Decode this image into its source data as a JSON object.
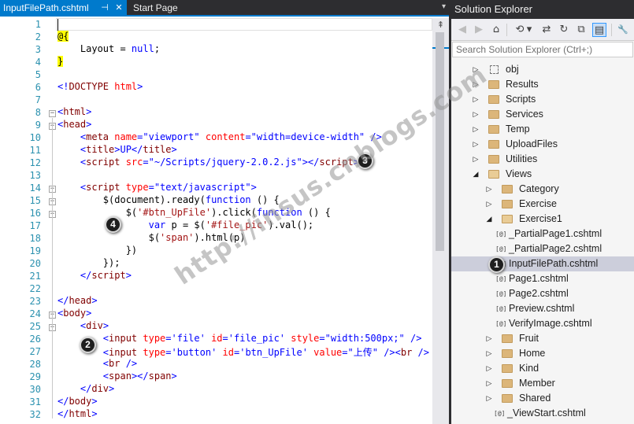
{
  "editor": {
    "active_tab": "InputFilePath.cshtml",
    "active_tab_pin": "⊣",
    "active_tab_close": "✕",
    "second_tab": "Start Page",
    "dropdown": "▾",
    "splitter": "⇞",
    "line_numbers": [
      "1",
      "2",
      "3",
      "4",
      "5",
      "6",
      "7",
      "8",
      "9",
      "10",
      "11",
      "12",
      "13",
      "14",
      "15",
      "16",
      "17",
      "18",
      "19",
      "20",
      "21",
      "22",
      "23",
      "24",
      "25",
      "26",
      "27",
      "28",
      "29",
      "30",
      "31",
      "32"
    ],
    "code": {
      "l2": "@{",
      "l3_a": "    Layout = ",
      "l3_b": "null",
      "l3_c": ";",
      "l4": "}",
      "l6_a": "<!",
      "l6_b": "DOCTYPE",
      "l6_c": " html",
      "l6_d": ">",
      "l8_a": "<",
      "l8_b": "html",
      "l8_c": ">",
      "l9_b": "head",
      "l10_a": "    <",
      "l10_b": "meta",
      "l10_c": " name",
      "l10_d": "=\"viewport\"",
      "l10_e": " content",
      "l10_f": "=\"width=device-width\"",
      "l10_g": " />",
      "l11_a": "    <",
      "l11_b": "title",
      "l11_c": ">UP</",
      "l11_d": "title",
      "l11_e": ">",
      "l12_a": "    <",
      "l12_b": "script",
      "l12_c": " src",
      "l12_d": "=\"~/Scripts/jquery-2.0.2.js\"",
      "l12_e": "></",
      "l12_f": "script",
      "l12_g": ">",
      "l14_a": "    <",
      "l14_b": "script",
      "l14_c": " type",
      "l14_d": "=\"text/javascript\"",
      "l14_e": ">",
      "l15_a": "        $(document).ready(",
      "l15_b": "function",
      "l15_c": " () {",
      "l16_a": "            $(",
      "l16_b": "'#btn_UpFile'",
      "l16_c": ").click(",
      "l16_d": "function",
      "l16_e": " () {",
      "l17_a": "                ",
      "l17_b": "var",
      "l17_c": " p = $(",
      "l17_d": "'#file_pic'",
      "l17_e": ").val();",
      "l18_a": "                $(",
      "l18_b": "'span'",
      "l18_c": ").html(p)",
      "l19": "            })",
      "l20": "        });",
      "l21_a": "    </",
      "l21_b": "script",
      "l21_c": ">",
      "l23_a": "</",
      "l23_b": "head",
      "l23_c": ">",
      "l24_b": "body",
      "l25_a": "    <",
      "l25_b": "div",
      "l25_c": ">",
      "l26_a": "        <",
      "l26_b": "input",
      "l26_c": " type",
      "l26_d": "='file'",
      "l26_e": " id",
      "l26_f": "='file_pic'",
      "l26_g": " style",
      "l26_h": "=\"width:500px;\"",
      "l26_i": " />",
      "l27_a": "        <",
      "l27_b": "input",
      "l27_c": " type",
      "l27_d": "='button'",
      "l27_e": " id",
      "l27_f": "='btn_UpFile'",
      "l27_g": " value",
      "l27_h": "=\"上传\"",
      "l27_i": " /><",
      "l27_j": "br",
      "l27_k": " />",
      "l28_a": "        <",
      "l28_b": "br",
      "l28_c": " />",
      "l29_a": "        <",
      "l29_b": "span",
      "l29_c": "></",
      "l29_d": "span",
      "l29_e": ">",
      "l30_a": "    </",
      "l30_b": "div",
      "l30_c": ">",
      "l31_a": "</",
      "l31_b": "body",
      "l31_c": ">",
      "l32_a": "</",
      "l32_b": "html",
      "l32_c": ">"
    }
  },
  "solution_explorer": {
    "title": "Solution Explorer",
    "search_placeholder": "Search Solution Explorer (Ctrl+;)",
    "toolbar_icons": {
      "back": "◀",
      "forward": "▶",
      "home": "⌂",
      "history": "⟲",
      "dropdown": "▾",
      "sync": "⇄",
      "refresh": "↻",
      "collapse": "⧉",
      "show_all": "▤",
      "properties": "🔧"
    },
    "file_glyph": "[@]",
    "tree": [
      {
        "label": "obj",
        "kind": "dotbox",
        "expander": "▷",
        "level": 0
      },
      {
        "label": "Results",
        "kind": "folder",
        "expander": "▷",
        "level": 0
      },
      {
        "label": "Scripts",
        "kind": "folder",
        "expander": "▷",
        "level": 0
      },
      {
        "label": "Services",
        "kind": "folder",
        "expander": "▷",
        "level": 0
      },
      {
        "label": "Temp",
        "kind": "folder",
        "expander": "▷",
        "level": 0
      },
      {
        "label": "UploadFiles",
        "kind": "folder",
        "expander": "▷",
        "level": 0
      },
      {
        "label": "Utilities",
        "kind": "folder",
        "expander": "▷",
        "level": 0
      },
      {
        "label": "Views",
        "kind": "folder-open",
        "expander": "◢",
        "level": 0
      },
      {
        "label": "Category",
        "kind": "folder",
        "expander": "▷",
        "level": 1
      },
      {
        "label": "Exercise",
        "kind": "folder",
        "expander": "▷",
        "level": 1
      },
      {
        "label": "Exercise1",
        "kind": "folder-open",
        "expander": "◢",
        "level": 1
      },
      {
        "label": "_PartialPage1.cshtml",
        "kind": "file",
        "expander": "",
        "level": 2
      },
      {
        "label": "_PartialPage2.cshtml",
        "kind": "file",
        "expander": "",
        "level": 2
      },
      {
        "label": "InputFilePath.cshtml",
        "kind": "file",
        "expander": "",
        "level": 2,
        "selected": true
      },
      {
        "label": "Page1.cshtml",
        "kind": "file",
        "expander": "",
        "level": 2
      },
      {
        "label": "Page2.cshtml",
        "kind": "file",
        "expander": "",
        "level": 2
      },
      {
        "label": "Preview.cshtml",
        "kind": "file",
        "expander": "",
        "level": 2
      },
      {
        "label": "VerifyImage.cshtml",
        "kind": "file",
        "expander": "",
        "level": 2
      },
      {
        "label": "Fruit",
        "kind": "folder",
        "expander": "▷",
        "level": 1
      },
      {
        "label": "Home",
        "kind": "folder",
        "expander": "▷",
        "level": 1
      },
      {
        "label": "Kind",
        "kind": "folder",
        "expander": "▷",
        "level": 1
      },
      {
        "label": "Member",
        "kind": "folder",
        "expander": "▷",
        "level": 1
      },
      {
        "label": "Shared",
        "kind": "folder",
        "expander": "▷",
        "level": 1
      },
      {
        "label": "_ViewStart.cshtml",
        "kind": "file",
        "expander": "",
        "level": 1
      }
    ]
  },
  "annotations": {
    "m1": "1",
    "m2": "2",
    "m3": "3",
    "m4": "4",
    "watermark": "http://insus.cnblogs.com"
  }
}
